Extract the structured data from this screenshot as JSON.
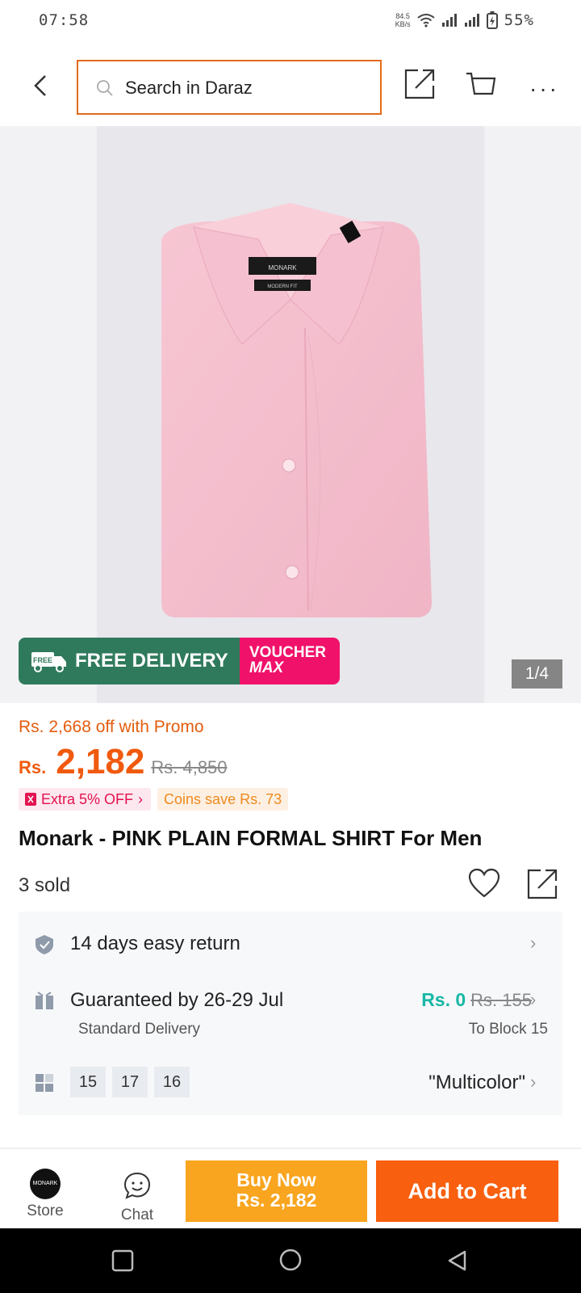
{
  "status": {
    "time": "07:58",
    "speed_top": "84.5",
    "speed_unit": "KB/s",
    "battery": "55%"
  },
  "header": {
    "search_placeholder": "Search in Daraz"
  },
  "gallery": {
    "banner_free": "FREE",
    "banner_free_delivery": "FREE DELIVERY",
    "banner_voucher": "VOUCHER",
    "banner_max": "MAX",
    "counter": "1/4",
    "brand_label": "MONARK",
    "fit_label": "MODERN FIT"
  },
  "price": {
    "promo": "Rs. 2,668 off with Promo",
    "currency": "Rs.",
    "amount": "2,182",
    "original": "Rs. 4,850",
    "tag_extra": "Extra 5% OFF",
    "tag_coins": "Coins save Rs. 73"
  },
  "product": {
    "title": "Monark - PINK PLAIN FORMAL SHIRT For Men",
    "sold": "3 sold"
  },
  "info": {
    "return_label": "14 days easy return",
    "delivery_label": "Guaranteed by 26-29 Jul",
    "delivery_type": "Standard Delivery",
    "ship_now": "Rs. 0",
    "ship_was": "Rs. 155",
    "ship_to": "To Block 15",
    "sizes": [
      "15",
      "17",
      "16"
    ],
    "color": "\"Multicolor\""
  },
  "bottom": {
    "store_label": "Store",
    "store_logo": "MONARK",
    "chat_label": "Chat",
    "buy_line1": "Buy Now",
    "buy_line2": "Rs. 2,182",
    "add_to_cart": "Add to Cart"
  },
  "colors": {
    "accent": "#f85f0e",
    "buy": "#f9a51f",
    "voucher": "#f0126a",
    "delivery": "#2f7a5c",
    "teal": "#18b8a4"
  }
}
